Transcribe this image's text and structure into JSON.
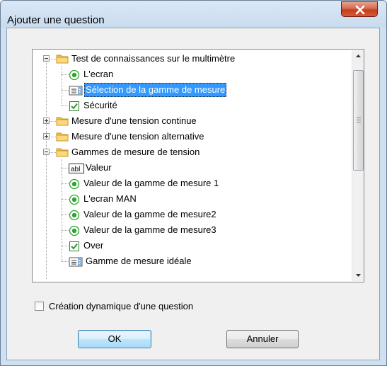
{
  "window": {
    "title": "Ajouter une question"
  },
  "tree": {
    "items": [
      {
        "label": "Test de connaissances sur le multimètre",
        "type": "folder",
        "expanded": true
      },
      {
        "label": "L'ecran",
        "type": "radio"
      },
      {
        "label": "Sélection de la gamme de mesure",
        "type": "list",
        "selected": true
      },
      {
        "label": "Sécurité",
        "type": "checkbox"
      },
      {
        "label": "Mesure d'une tension continue",
        "type": "folder",
        "expanded": false
      },
      {
        "label": "Mesure d'une tension alternative",
        "type": "folder",
        "expanded": false
      },
      {
        "label": "Gammes de mesure de tension",
        "type": "folder",
        "expanded": true
      },
      {
        "label": "Valeur",
        "type": "textbox"
      },
      {
        "label": "Valeur de la gamme de mesure 1",
        "type": "radio"
      },
      {
        "label": "L'ecran MAN",
        "type": "radio"
      },
      {
        "label": "Valeur de la gamme de mesure2",
        "type": "radio"
      },
      {
        "label": "Valeur de la gamme de mesure3",
        "type": "radio"
      },
      {
        "label": "Over",
        "type": "checkbox"
      },
      {
        "label": "Gamme de mesure idéale",
        "type": "list"
      }
    ]
  },
  "options": {
    "dynamic_label": "Création dynamique d'une question",
    "dynamic_checked": false
  },
  "buttons": {
    "ok_label": "OK",
    "cancel_label": "Annuler"
  },
  "colors": {
    "selection": "#3399ff",
    "radio": "#2fa52f",
    "close": "#c4401d"
  }
}
